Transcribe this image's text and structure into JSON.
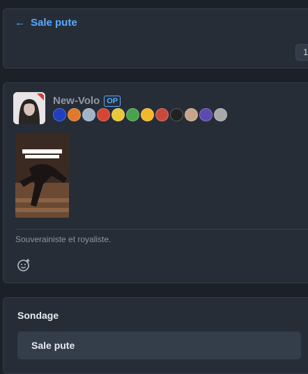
{
  "header": {
    "back_icon": "arrow-left-icon",
    "title": "Sale pute",
    "page_indicator": "1"
  },
  "post": {
    "author": "New-Volo",
    "op_badge": "OP",
    "avatar": "user-avatar",
    "badges": [
      {
        "name": "badge-1",
        "color": "#1e3fbf"
      },
      {
        "name": "badge-2",
        "color": "#e07a2a"
      },
      {
        "name": "badge-3",
        "color": "#9fb4c8"
      },
      {
        "name": "badge-4",
        "color": "#d64532"
      },
      {
        "name": "badge-5",
        "color": "#e8c83a"
      },
      {
        "name": "badge-6",
        "color": "#4aa24a"
      },
      {
        "name": "badge-7",
        "color": "#f2b829"
      },
      {
        "name": "badge-8",
        "color": "#c94a3d"
      },
      {
        "name": "badge-9",
        "color": "#222222"
      },
      {
        "name": "badge-10",
        "color": "#c8a48c"
      },
      {
        "name": "badge-11",
        "color": "#5b4bb0"
      },
      {
        "name": "badge-12",
        "color": "#a8a8a8"
      }
    ],
    "bio": "Souverainiste et royaliste.",
    "react_icon": "smiley-add-icon"
  },
  "poll": {
    "title": "Sondage",
    "option": "Sale pute"
  },
  "colors": {
    "accent": "#5aa9ff",
    "card": "#262d37",
    "background": "#1c2027"
  }
}
